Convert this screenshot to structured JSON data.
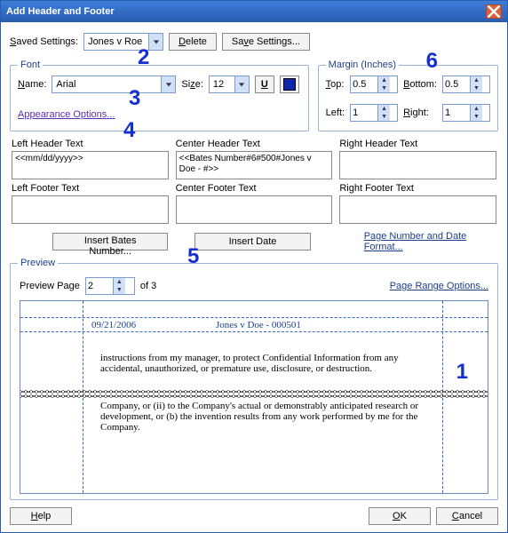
{
  "title": "Add Header and Footer",
  "saved": {
    "label": "Saved Settings:",
    "value": "Jones v Roe",
    "delete": "Delete",
    "save": "Save Settings..."
  },
  "font": {
    "legend": "Font",
    "name_label": "Name:",
    "name_value": "Arial",
    "size_label": "Size:",
    "size_value": "12",
    "underline_label": "U",
    "appearance_link": "Appearance Options..."
  },
  "margins": {
    "legend": "Margin (Inches)",
    "top_label": "Top:",
    "top_value": "0.5",
    "bottom_label": "Bottom:",
    "bottom_value": "0.5",
    "left_label": "Left:",
    "left_value": "1",
    "right_label": "Right:",
    "right_value": "1"
  },
  "headers": {
    "left_header_label": "Left Header Text",
    "left_header_value": "<<mm/dd/yyyy>>",
    "center_header_label": "Center Header Text",
    "center_header_value": "<<Bates Number#6#500#Jones v Doe  - #>>",
    "right_header_label": "Right Header Text",
    "right_header_value": "",
    "left_footer_label": "Left Footer Text",
    "left_footer_value": "",
    "center_footer_label": "Center Footer Text",
    "center_footer_value": "",
    "right_footer_label": "Right Footer Text",
    "right_footer_value": ""
  },
  "insert": {
    "bates": "Insert Bates Number...",
    "date": "Insert Date",
    "format_link": "Page Number and Date Format..."
  },
  "preview": {
    "legend": "Preview",
    "page_label": "Preview Page",
    "page_value": "2",
    "of_label": "of 3",
    "range_link": "Page Range Options...",
    "date_text": "09/21/2006",
    "bates_text": "Jones v Doe  -  000501",
    "body_top": "instructions from my manager, to protect Confidential Information from any accidental, unauthorized, or premature use, disclosure, or destruction.",
    "body_bottom": "Company, or (ii) to the Company's actual or demonstrably anticipated research or development, or (b) the invention results from any work performed by me for the Company."
  },
  "buttons": {
    "help": "Help",
    "ok": "OK",
    "cancel": "Cancel"
  },
  "annotations": {
    "a1": "1",
    "a2": "2",
    "a3": "3",
    "a4": "4",
    "a5": "5",
    "a6": "6"
  }
}
